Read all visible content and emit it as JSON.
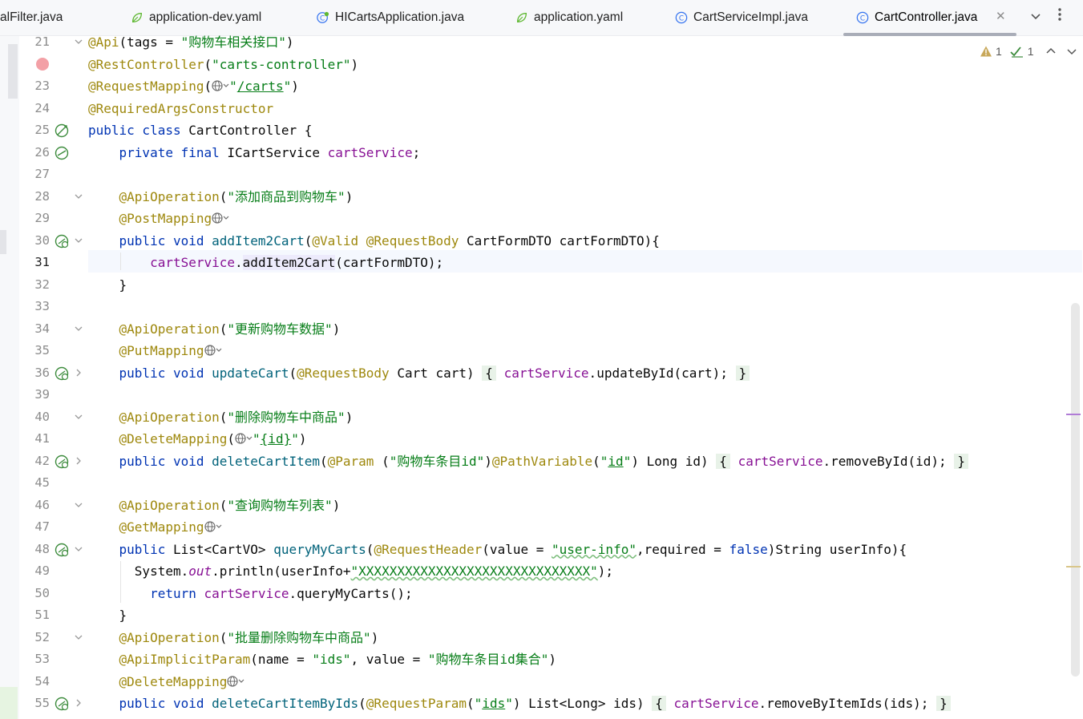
{
  "tabs": [
    {
      "label": "alFilter.java",
      "icon": "java-class-icon",
      "active": false
    },
    {
      "label": "application-dev.yaml",
      "icon": "yaml-leaf-icon",
      "active": false
    },
    {
      "label": "HICartsApplication.java",
      "icon": "spring-app-icon",
      "active": false
    },
    {
      "label": "application.yaml",
      "icon": "yaml-leaf-icon",
      "active": false
    },
    {
      "label": "CartServiceImpl.java",
      "icon": "java-class-icon",
      "active": false
    },
    {
      "label": "CartController.java",
      "icon": "java-class-icon",
      "active": true
    }
  ],
  "inspections": {
    "warnings": "1",
    "ok": "1"
  },
  "line_numbers": [
    "21",
    "22",
    "23",
    "24",
    "25",
    "26",
    "27",
    "28",
    "29",
    "30",
    "31",
    "32",
    "33",
    "34",
    "35",
    "36",
    "39",
    "40",
    "41",
    "42",
    "45",
    "46",
    "47",
    "48",
    "49",
    "50",
    "51",
    "52",
    "53",
    "54",
    "55"
  ],
  "current_line": "31",
  "code": {
    "l21": {
      "a": "@Api",
      "b": "(tags = ",
      "c": "\"购物车相关接口\"",
      "d": ")"
    },
    "l22": {
      "a": "@RestController",
      "b": "(",
      "c": "\"carts-controller\"",
      "d": ")"
    },
    "l23": {
      "a": "@RequestMapping",
      "b": "(",
      "c": "\"",
      "d": "/carts",
      "e": "\"",
      "f": ")"
    },
    "l24": {
      "a": "@RequiredArgsConstructor"
    },
    "l25": {
      "a": "public class ",
      "b": "CartController {"
    },
    "l26": {
      "a": "private final ",
      "b": "ICartService ",
      "c": "cartService",
      "d": ";"
    },
    "l28": {
      "a": "@ApiOperation",
      "b": "(",
      "c": "\"添加商品到购物车\"",
      "d": ")"
    },
    "l29": {
      "a": "@PostMapping"
    },
    "l30": {
      "a": "public void ",
      "b": "addItem2Cart",
      "c": "(",
      "d": "@Valid @RequestBody ",
      "e": "CartFormDTO cartFormDTO){"
    },
    "l31": {
      "a": "cartService",
      ".": ".",
      "b": "addItem2Cart",
      "c": "(cartFormDTO);"
    },
    "l32": {
      "a": "}"
    },
    "l34": {
      "a": "@ApiOperation",
      "b": "(",
      "c": "\"更新购物车数据\"",
      "d": ")"
    },
    "l35": {
      "a": "@PutMapping"
    },
    "l36": {
      "a": "public void ",
      "b": "updateCart",
      "c": "(",
      "d": "@RequestBody ",
      "e": "Cart cart) ",
      "f": "{",
      "g": "cartService",
      ".": ".",
      "h": "updateById(cart);",
      "i": "}"
    },
    "l40": {
      "a": "@ApiOperation",
      "b": "(",
      "c": "\"删除购物车中商品\"",
      "d": ")"
    },
    "l41": {
      "a": "@DeleteMapping",
      "b": "(",
      "c": "\"",
      "d": "{id}",
      "e": "\"",
      "f": ")"
    },
    "l42": {
      "a": "public void ",
      "b": "deleteCartItem",
      "c": "(",
      "d": "@Param ",
      "e": "(",
      "f": "\"购物车条目id\"",
      "g": ")",
      "h": "@PathVariable",
      "i": "(",
      "j": "\"",
      "k": "id",
      "l": "\"",
      ")": ") Long id) ",
      "m": "{",
      "n": "cartService",
      ".": ".",
      "o": "removeById(id);",
      "p": "}"
    },
    "l46": {
      "a": "@ApiOperation",
      "b": "(",
      "c": "\"查询购物车列表\"",
      "d": ")"
    },
    "l47": {
      "a": "@GetMapping"
    },
    "l48": {
      "a": "public ",
      "b": "List<CartVO> ",
      "c": "queryMyCarts",
      "d": "(",
      "e": "@RequestHeader",
      "f": "(value = ",
      "g": "\"user-info\"",
      "h": ",required = ",
      "i": "false",
      "j": ")String userInfo){"
    },
    "l49": {
      "a": "System.",
      "b": "out",
      "c": ".println(userInfo+",
      "d": "\"XXXXXXXXXXXXXXXXXXXXXXXXXXXXXX\"",
      "e": ");"
    },
    "l50": {
      "a": "return ",
      "b": "cartService",
      "c": ".queryMyCarts();"
    },
    "l51": {
      "a": "}"
    },
    "l52": {
      "a": "@ApiOperation",
      "b": "(",
      "c": "\"批量删除购物车中商品\"",
      "d": ")"
    },
    "l53": {
      "a": "@ApiImplicitParam",
      "b": "(name = ",
      "c": "\"ids\"",
      "d": ", value = ",
      "e": "\"购物车条目id集合\"",
      "f": ")"
    },
    "l54": {
      "a": "@DeleteMapping"
    },
    "l55": {
      "a": "public void ",
      "b": "deleteCartItemByIds",
      "c": "(",
      "d": "@RequestParam",
      "e": "(",
      "f": "\"",
      "g": "ids",
      "h": "\"",
      "i": ") List<Long> ids) ",
      "j": "{",
      "k": "cartService",
      ".": ".",
      "l": "removeByItemIds(ids);",
      "m": "}"
    }
  },
  "colors": {
    "keyword": "#0033b3",
    "annotation": "#9e880d",
    "string": "#067d17",
    "field": "#871094",
    "method": "#00627a",
    "current_line": "#f5f8fe"
  }
}
